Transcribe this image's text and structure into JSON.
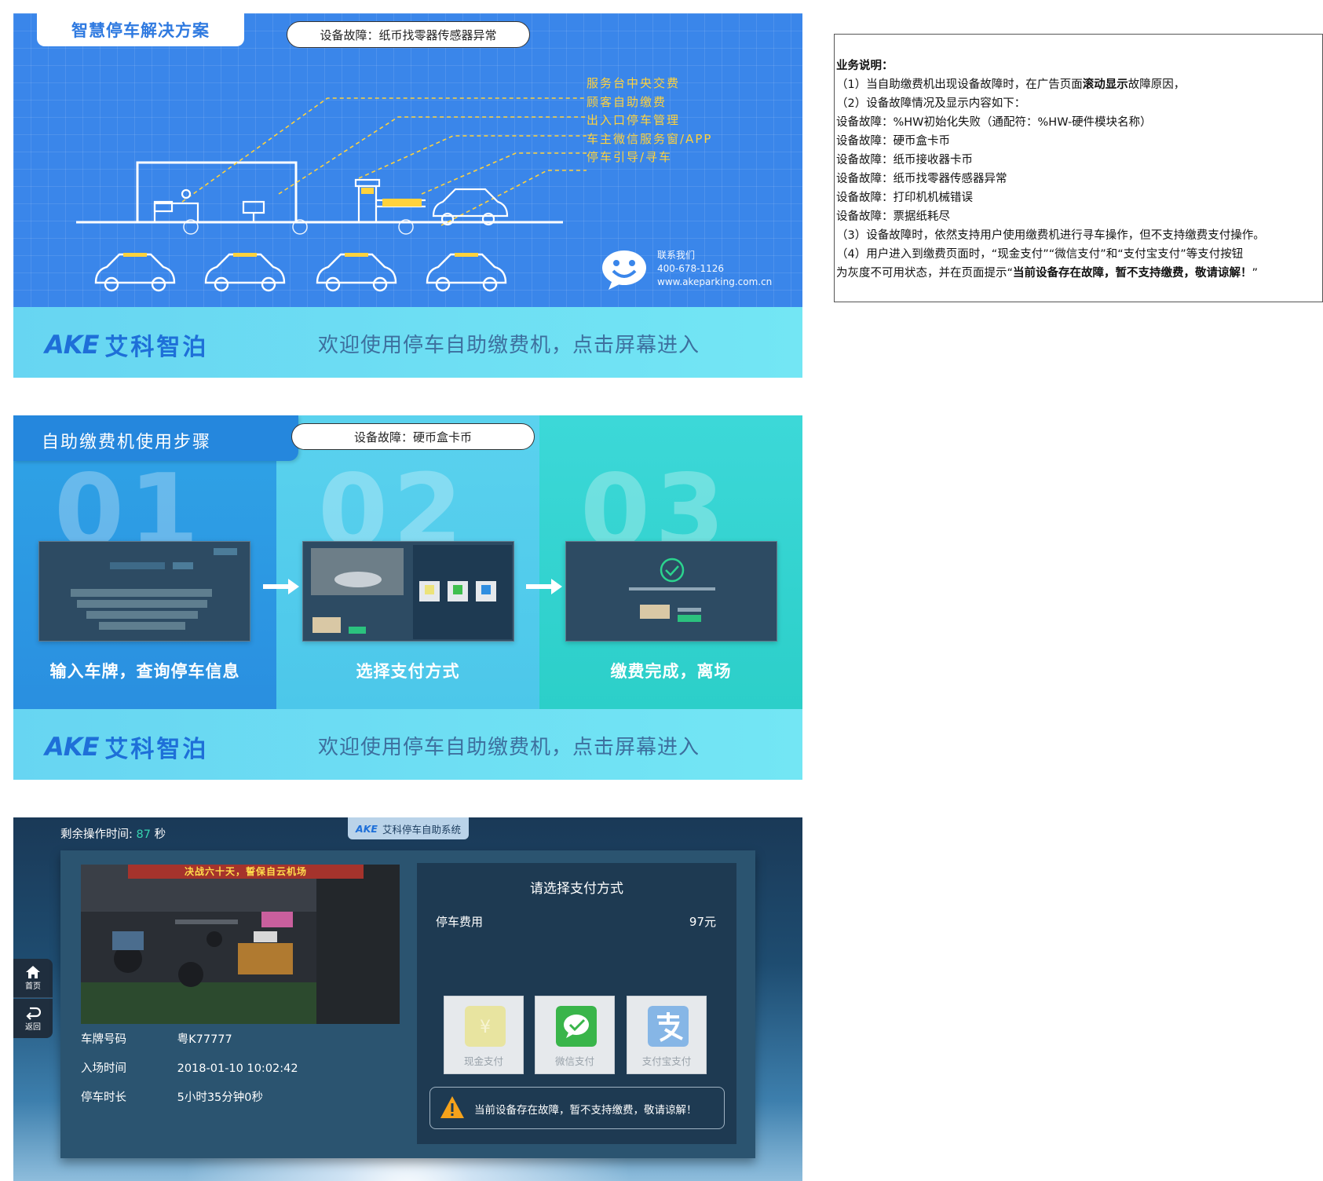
{
  "panel1": {
    "title": "智慧停车解决方案",
    "alert": "设备故障：纸币找零器传感器异常",
    "services": [
      "服务台中央交费",
      "顾客自助缴费",
      "出入口停车管理",
      "车主微信服务窗/APP",
      "停车引导/寻车"
    ],
    "contact": {
      "label": "联系我们",
      "phone": "400-678-1126",
      "website": "www.akeparking.com.cn"
    }
  },
  "brand": {
    "logo": "AKE",
    "name": "艾科智泊",
    "welcome": "欢迎使用停车自助缴费机，点击屏幕进入"
  },
  "notes": {
    "heading": "业务说明：",
    "line1_prefix": "（1）当自助缴费机出现设备故障时，在广告页面",
    "line1_bold": "滚动显示",
    "line1_suffix": "故障原因，",
    "line2": "（2）设备故障情况及显示内容如下：",
    "faults": [
      "设备故障：%HW初始化失败（通配符：%HW-硬件模块名称）",
      "设备故障：硬币盒卡币",
      "设备故障：纸币接收器卡币",
      "设备故障：纸币找零器传感器异常",
      "设备故障：打印机机械错误",
      "设备故障：票据纸耗尽"
    ],
    "line3": "（3）设备故障时，依然支持用户使用缴费机进行寻车操作，但不支持缴费支付操作。",
    "line4": "（4）用户进入到缴费页面时，“现金支付”“微信支付”和“支付宝支付”等支付按钮",
    "line5_prefix": "为灰度不可用状态，并在页面提示“",
    "line5_bold": "当前设备存在故障，暂不支持缴费，敬请谅解！",
    "line5_suffix": "”"
  },
  "panel2": {
    "title": "自助缴费机使用步骤",
    "alert": "设备故障：硬币盒卡币",
    "steps": [
      {
        "num": "01",
        "label": "输入车牌，查询停车信息"
      },
      {
        "num": "02",
        "label": "选择支付方式"
      },
      {
        "num": "03",
        "label": "缴费完成，离场"
      }
    ]
  },
  "panel3": {
    "timer_label": "剩余操作时间:",
    "timer_value": "87",
    "timer_unit": "秒",
    "system_logo": "AKE",
    "system_name": "艾科停车自助系统",
    "camera_banner": "决战六十天，誓保自云机场",
    "info": {
      "plate_label": "车牌号码",
      "plate_value": "粤K77777",
      "entry_label": "入场时间",
      "entry_value": "2018-01-10 10:02:42",
      "duration_label": "停车时长",
      "duration_value": "5小时35分钟0秒"
    },
    "payment": {
      "title": "请选择支付方式",
      "fee_label": "停车费用",
      "fee_value": "97元",
      "methods": [
        "现金支付",
        "微信支付",
        "支付宝支付"
      ],
      "fault_message": "当前设备存在故障，暂不支持缴费，敬请谅解！"
    },
    "side": {
      "home": "首页",
      "back": "返回"
    }
  },
  "colors": {
    "panel1_blue": "#3a86ea",
    "service_yellow": "#ffd23c",
    "brand_blue": "#1e6fd8",
    "timer_green": "#36d3b0",
    "card_dark": "#2b5470"
  }
}
